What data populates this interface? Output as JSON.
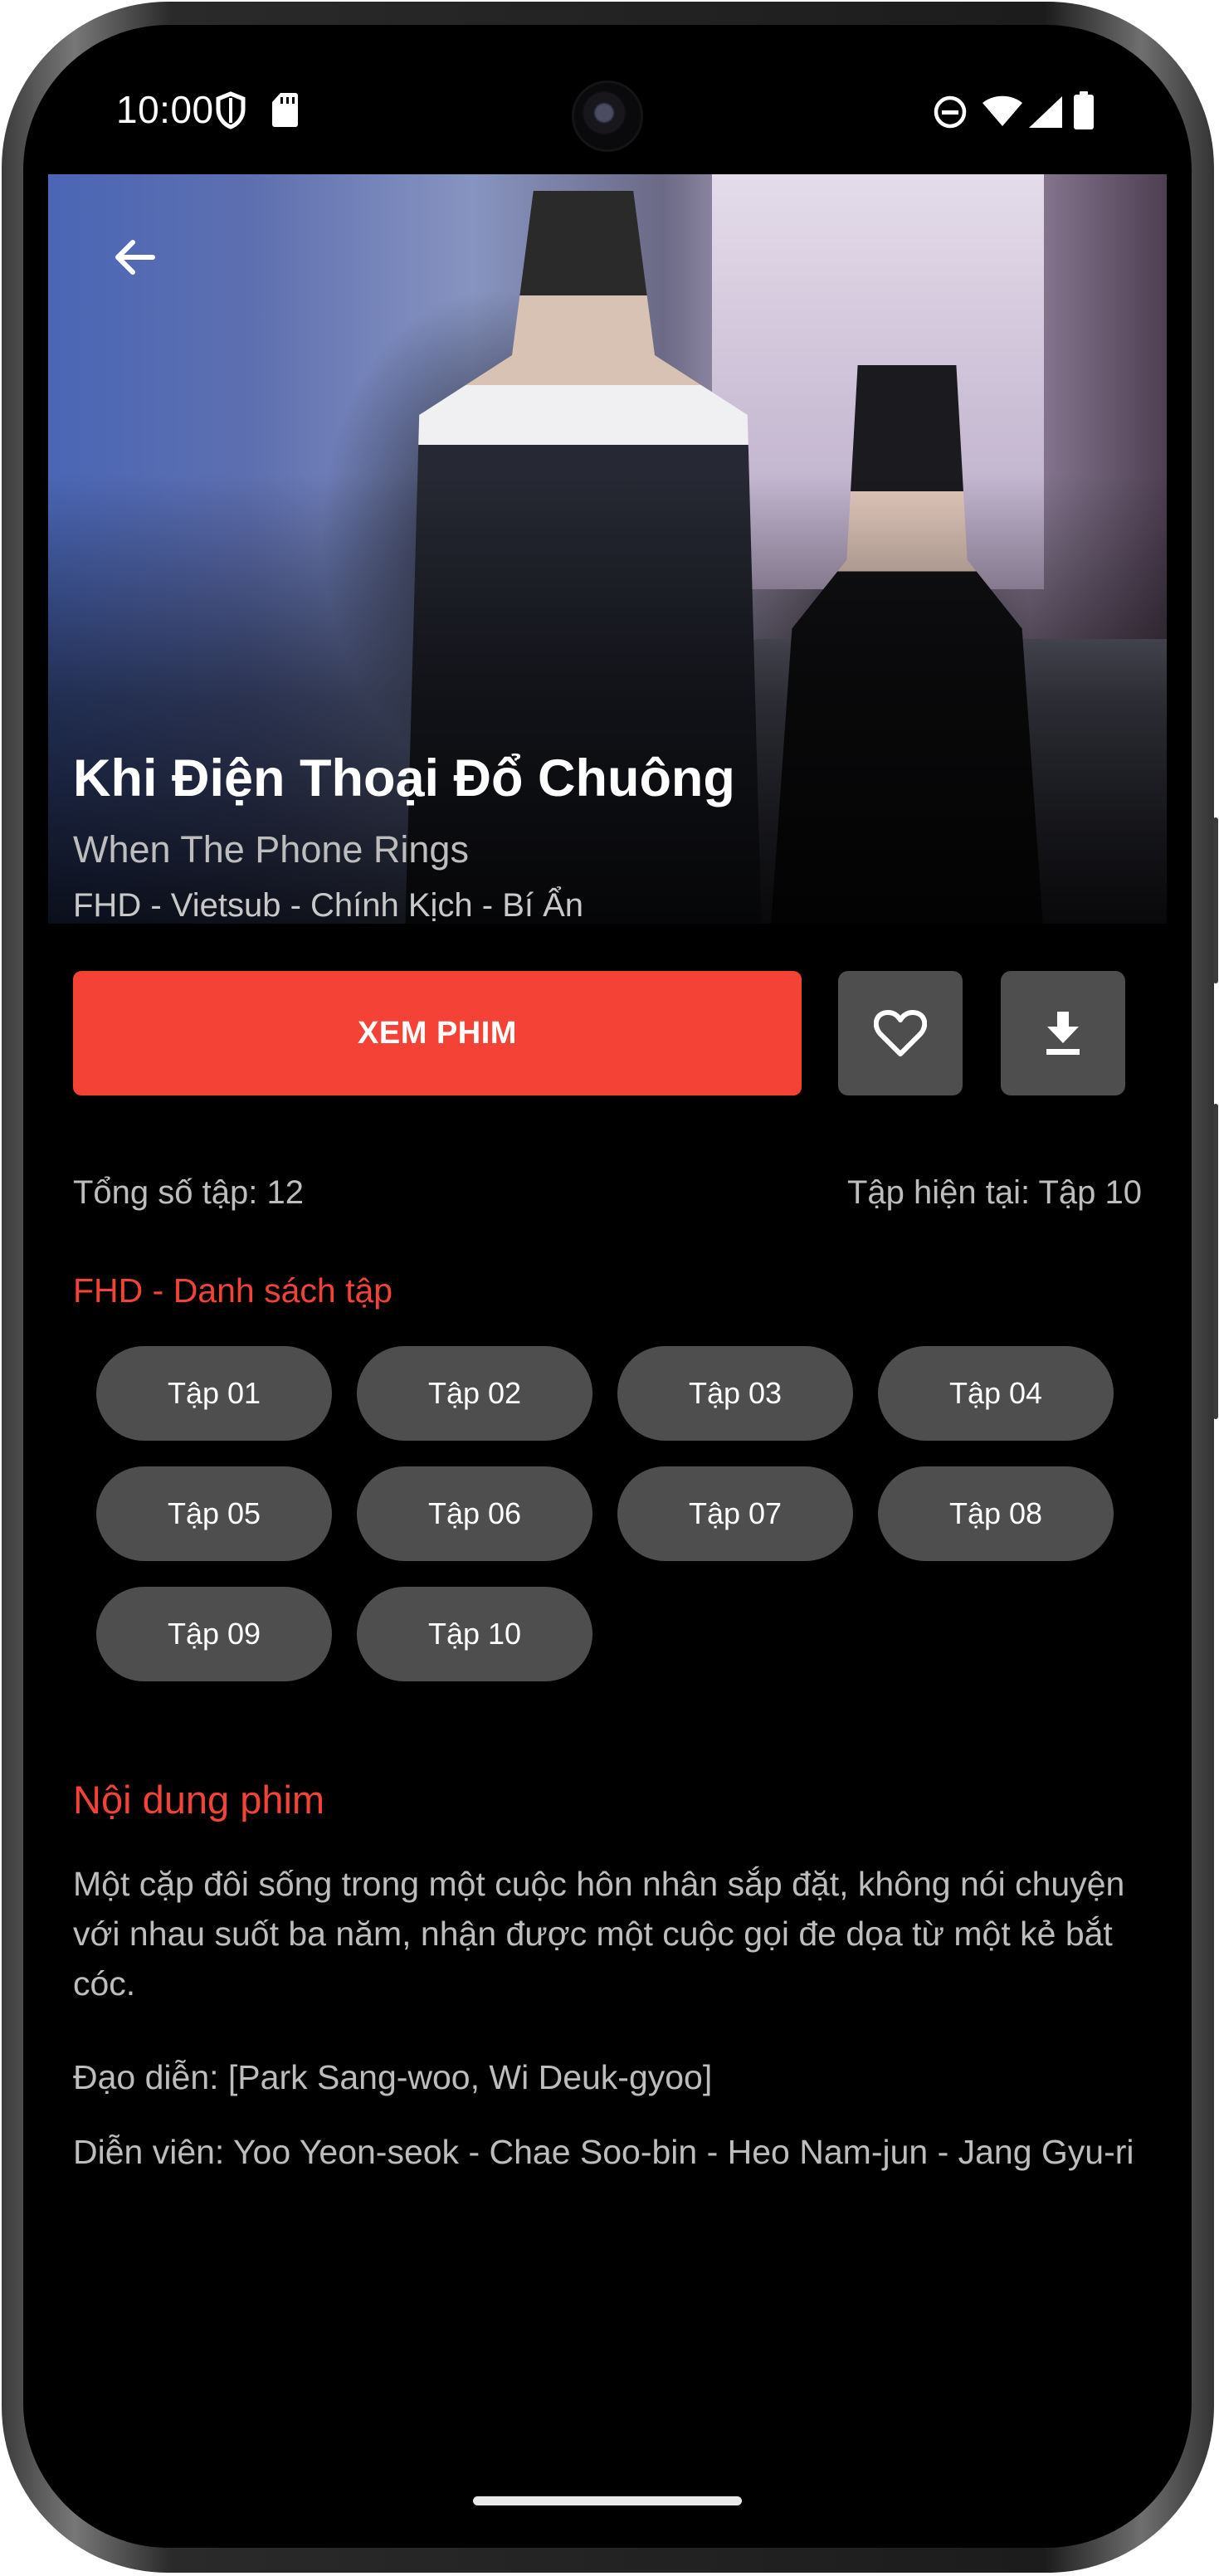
{
  "status_bar": {
    "time": "10:00",
    "icons": [
      "shield-icon",
      "sd-card-icon",
      "do-not-disturb-icon",
      "wifi-icon",
      "cellular-signal-icon",
      "battery-icon"
    ]
  },
  "movie": {
    "title": "Khi Điện Thoại Đổ Chuông",
    "original_title": "When The Phone Rings",
    "meta": "FHD - Vietsub - Chính Kịch - Bí Ẩn"
  },
  "actions": {
    "watch_label": "XEM PHIM",
    "favorite_icon": "heart-outline-icon",
    "download_icon": "download-icon"
  },
  "info": {
    "total_episodes": "Tổng số tập: 12",
    "current_episode": "Tập hiện tại: Tập 10"
  },
  "episodes": {
    "heading": "FHD - Danh sách tập",
    "items": [
      "Tập 01",
      "Tập 02",
      "Tập 03",
      "Tập 04",
      "Tập 05",
      "Tập 06",
      "Tập 07",
      "Tập 08",
      "Tập 09",
      "Tập 10"
    ]
  },
  "synopsis": {
    "heading": "Nội dung phim",
    "description": "Một cặp đôi sống trong một cuộc hôn nhân sắp đặt, không nói chuyện với nhau suốt ba năm, nhận được một cuộc gọi đe dọa từ một kẻ bắt cóc.",
    "director": "Đạo diễn: [Park Sang-woo, Wi Deuk-gyoo]",
    "cast": "Diễn viên: Yoo Yeon-seok - Chae Soo-bin - Heo Nam-jun - Jang Gyu-ri"
  },
  "colors": {
    "accent": "#f44336",
    "button_gray": "#4e4e4e",
    "background": "#000000",
    "text_secondary": "#bdbdbd"
  }
}
